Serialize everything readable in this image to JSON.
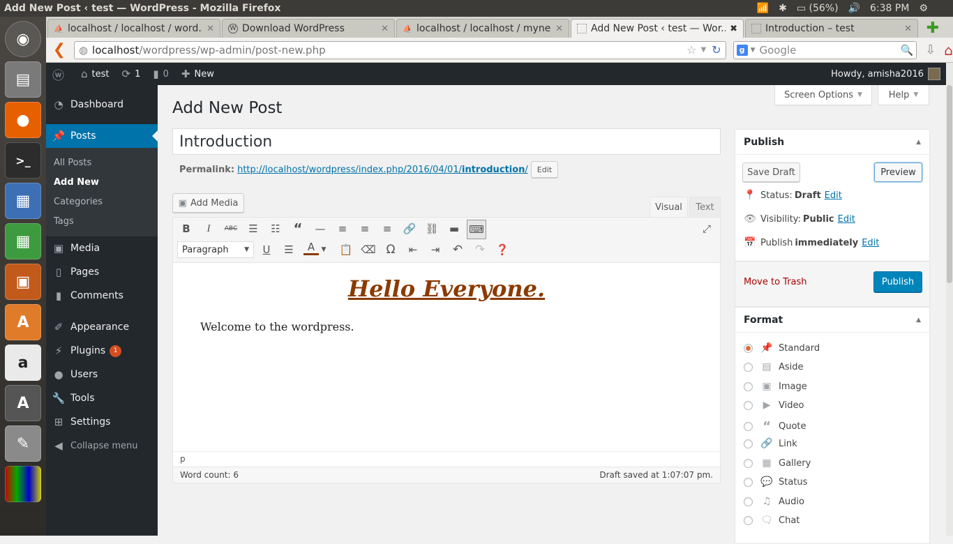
{
  "os": {
    "window_title": "Add New Post ‹ test — WordPress - Mozilla Firefox",
    "battery": "(56%)",
    "clock": "6:38 PM"
  },
  "browser": {
    "tabs": [
      {
        "label": "localhost / localhost / word...",
        "active": false
      },
      {
        "label": "Download WordPress",
        "active": false
      },
      {
        "label": "localhost / localhost / myne...",
        "active": false
      },
      {
        "label": "Add New Post ‹ test — Wor...",
        "active": true
      },
      {
        "label": "Introduction – test",
        "active": false
      }
    ],
    "url_host": "localhost",
    "url_path": "/wordpress/wp-admin/post-new.php",
    "search_placeholder": "Google"
  },
  "adminbar": {
    "site": "test",
    "updates": "1",
    "comments": "0",
    "new": "New",
    "howdy": "Howdy, amisha2016"
  },
  "menu": {
    "dashboard": "Dashboard",
    "posts": "Posts",
    "sub": [
      "All Posts",
      "Add New",
      "Categories",
      "Tags"
    ],
    "media": "Media",
    "pages": "Pages",
    "comments": "Comments",
    "appearance": "Appearance",
    "plugins": "Plugins",
    "plugins_badge": "1",
    "users": "Users",
    "tools": "Tools",
    "settings": "Settings",
    "collapse": "Collapse menu"
  },
  "screen_options": "Screen Options",
  "help": "Help",
  "page_title": "Add New Post",
  "post": {
    "title": "Introduction",
    "permalink_label": "Permalink:",
    "permalink_base": "http://localhost/wordpress/index.php/2016/04/01/",
    "permalink_slug": "introduction",
    "permalink_end": "/",
    "permalink_edit": "Edit"
  },
  "editor": {
    "add_media": "Add Media",
    "tab_visual": "Visual",
    "tab_text": "Text",
    "format": "Paragraph",
    "heading": "Hello Everyone.",
    "paragraph": "Welcome to the wordpress.",
    "path": "p",
    "word_count": "Word count: 6",
    "draft_saved": "Draft saved at 1:07:07 pm."
  },
  "publish": {
    "title": "Publish",
    "save_draft": "Save Draft",
    "preview": "Preview",
    "status_label": "Status:",
    "status_value": "Draft",
    "visibility_label": "Visibility:",
    "visibility_value": "Public",
    "publish_label": "Publish",
    "publish_value": "immediately",
    "edit": "Edit",
    "trash": "Move to Trash",
    "publish_btn": "Publish"
  },
  "format_box": {
    "title": "Format",
    "options": [
      "Standard",
      "Aside",
      "Image",
      "Video",
      "Quote",
      "Link",
      "Gallery",
      "Status",
      "Audio",
      "Chat"
    ],
    "selected": "Standard"
  }
}
